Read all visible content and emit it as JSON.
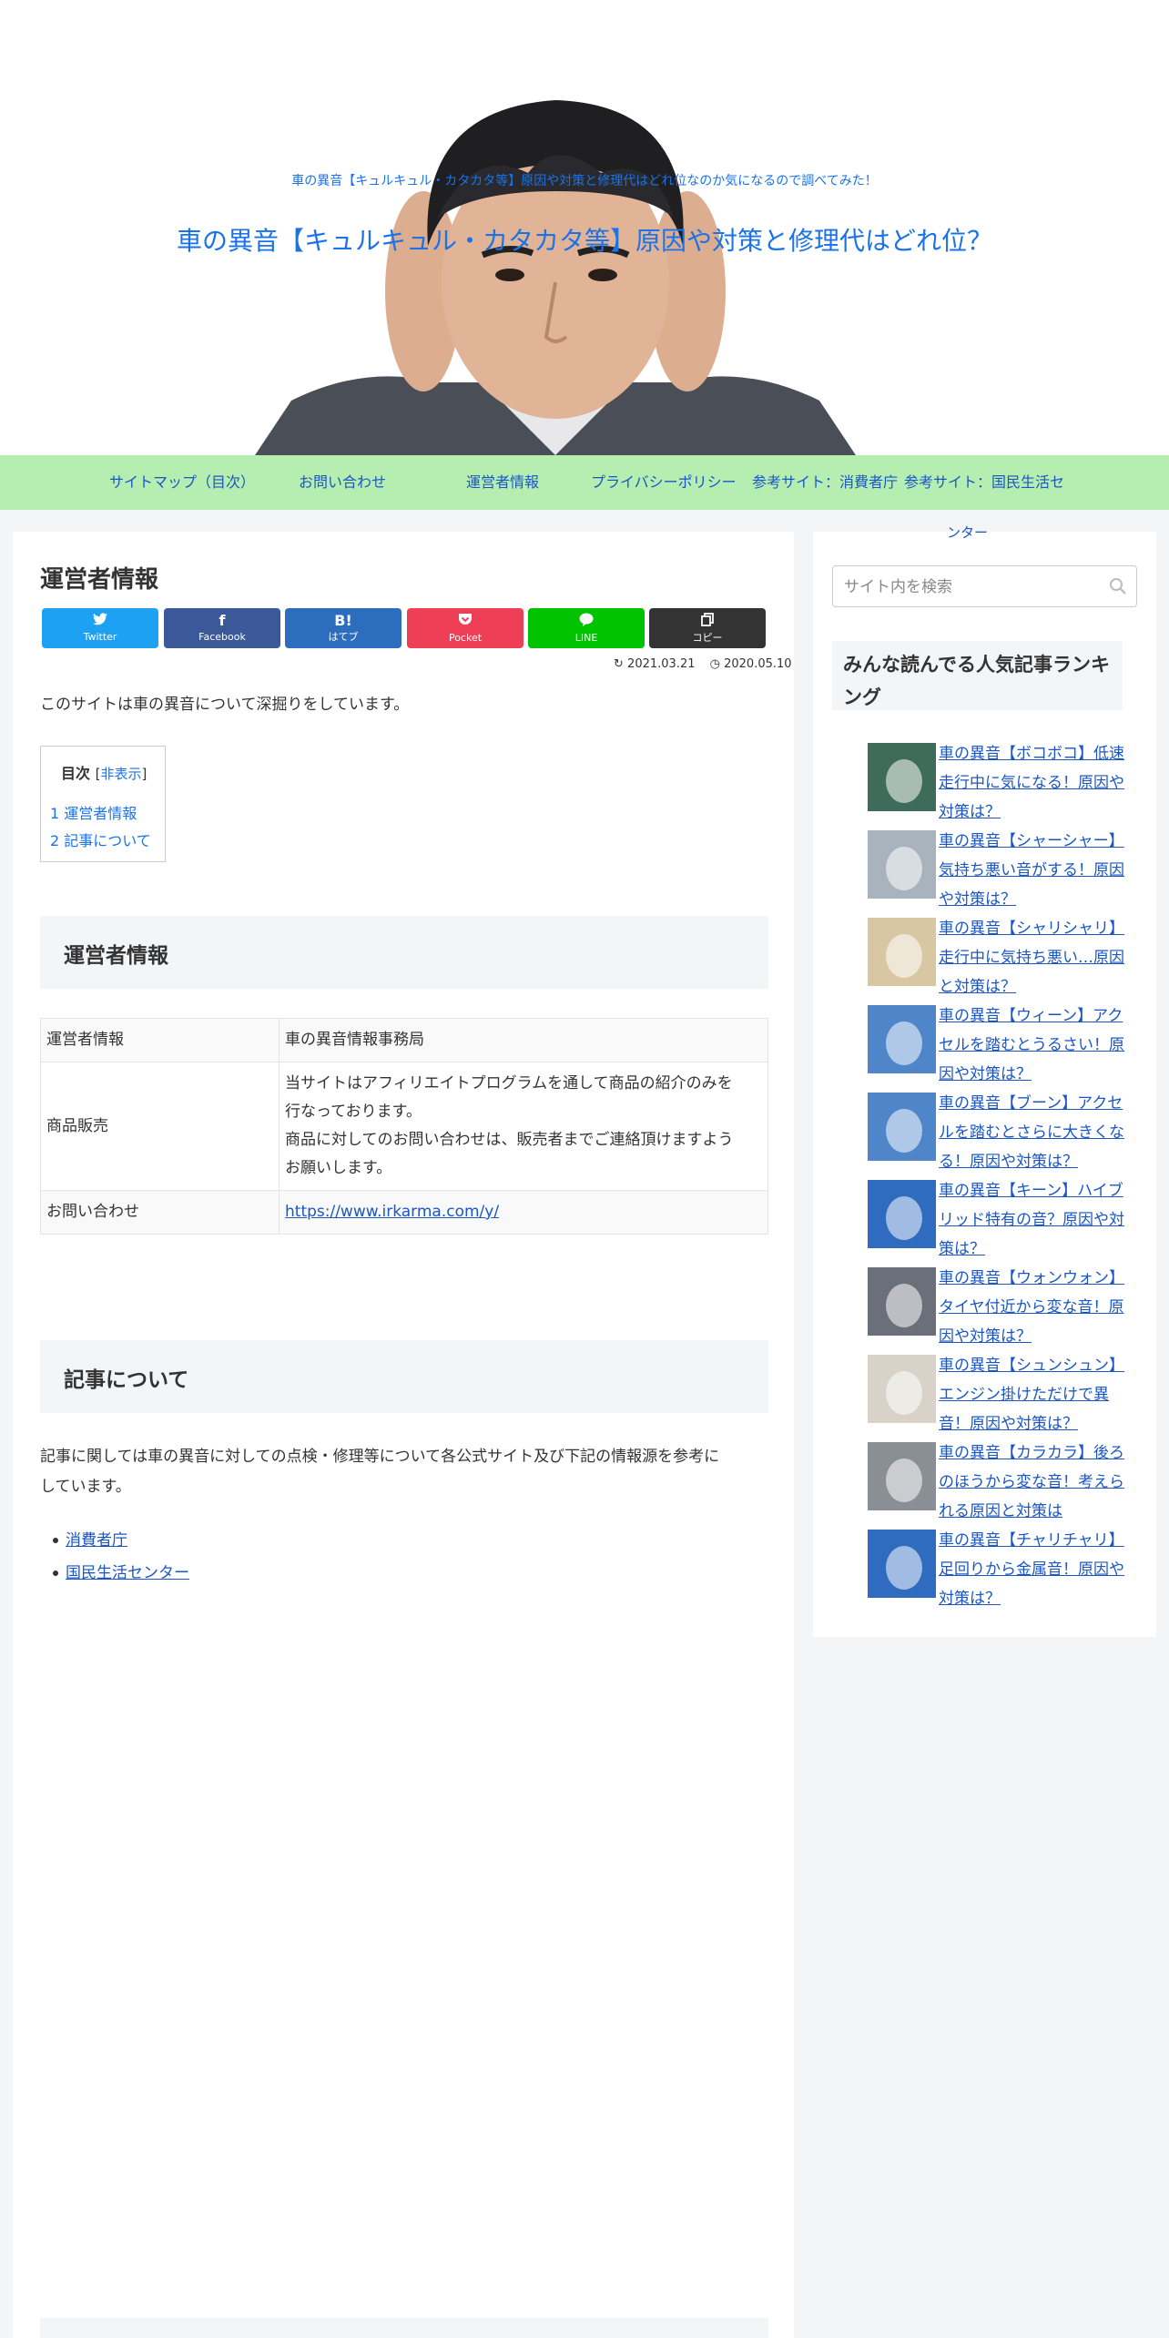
{
  "header": {
    "tagline": "車の異音【キュルキュル・カタカタ等】原因や対策と修理代はどれ位なのか気になるので調べてみた！",
    "title": "車の異音【キュルキュル・カタカタ等】原因や対策と修理代はどれ位？"
  },
  "nav": {
    "items": [
      "サイトマップ（目次）",
      "お問い合わせ",
      "運営者情報",
      "プライバシーポリシー",
      "参考サイト：消費者庁",
      "参考サイト：国民生活セ"
    ],
    "overflow": "ンター"
  },
  "post": {
    "title": "運営者情報",
    "share": [
      {
        "icon": "twitter-icon",
        "glyph": "🐦",
        "label": "Twitter",
        "color": "#1da1f2"
      },
      {
        "icon": "facebook-icon",
        "glyph": "f",
        "label": "Facebook",
        "color": "#3b5998"
      },
      {
        "icon": "hatebu-icon",
        "glyph": "B!",
        "label": "はてブ",
        "color": "#2c6ebd"
      },
      {
        "icon": "pocket-icon",
        "glyph": "⛉",
        "label": "Pocket",
        "color": "#ef3f56"
      },
      {
        "icon": "line-icon",
        "glyph": "💬",
        "label": "LINE",
        "color": "#00c300"
      },
      {
        "icon": "copy-icon",
        "glyph": "❐",
        "label": "コピー",
        "color": "#333333"
      }
    ],
    "updated": "2021.03.21",
    "published": "2020.05.10",
    "intro": "このサイトは車の異音について深掘りをしています。",
    "toc": {
      "title": "目次",
      "toggle": "非表示",
      "items": [
        "1 運営者情報",
        "2 記事について"
      ]
    },
    "section1_heading": "運営者情報",
    "table": [
      {
        "label": "運営者情報",
        "value": "車の異音情報事務局"
      },
      {
        "label": "商品販売",
        "value_line1": "当サイトはアフィリエイトプログラムを通して商品の紹介のみを",
        "value_line2": "行なっております。",
        "value_line3": "商品に対してのお問い合わせは、販売者までご連絡頂けますよう",
        "value_line4": "お願いします。"
      },
      {
        "label": "お問い合わせ",
        "value": "https://www.irkarma.com/y/"
      }
    ],
    "section2_heading": "記事について",
    "body_line1": "記事に関しては車の異音に対しての点検・修理等について各公式サイト及び下記の情報源を参考に",
    "body_line2": "しています。",
    "refs": [
      "消費者庁",
      "国民生活センター"
    ]
  },
  "sidebar": {
    "search_placeholder": "サイト内を検索",
    "widget_title_line1": "みんな読んでる人気記事ランキ",
    "widget_title_line2": "ング",
    "ranking": [
      {
        "lines": [
          "車の異音【ボコボコ】低速",
          "走行中に気になる！原因や",
          "対策は？"
        ],
        "thumb": "#3e6b5a"
      },
      {
        "lines": [
          "車の異音【シャーシャー】",
          "気持ち悪い音がする！原因",
          "や対策は？"
        ],
        "thumb": "#a9b3bd"
      },
      {
        "lines": [
          "車の異音【シャリシャリ】",
          "走行中に気持ち悪い…原因",
          "と対策は？"
        ],
        "thumb": "#d9c7a4"
      },
      {
        "lines": [
          "車の異音【ウィーン】アク",
          "セルを踏むとうるさい！原",
          "因や対策は？"
        ],
        "thumb": "#4f86c9"
      },
      {
        "lines": [
          "車の異音【ブーン】アクセ",
          "ルを踏むとさらに大きくな",
          "る！原因や対策は？"
        ],
        "thumb": "#4f86c9"
      },
      {
        "lines": [
          "車の異音【キーン】ハイブ",
          "リッド特有の音？原因や対",
          "策は？"
        ],
        "thumb": "#2f6cc0"
      },
      {
        "lines": [
          "車の異音【ウォンウォン】",
          "タイヤ付近から変な音！原",
          "因や対策は？"
        ],
        "thumb": "#6a6f7a"
      },
      {
        "lines": [
          "車の異音【シュンシュン】",
          "エンジン掛けただけで異",
          "音！原因や対策は？"
        ],
        "thumb": "#d8d2c8"
      },
      {
        "lines": [
          "車の異音【カラカラ】後ろ",
          "のほうから変な音！考えら",
          "れる原因と対策は"
        ],
        "thumb": "#8a8f96"
      },
      {
        "lines": [
          "車の異音【チャリチャリ】",
          "足回りから金属音！原因や",
          "対策は？"
        ],
        "thumb": "#2f6cc0"
      }
    ]
  }
}
